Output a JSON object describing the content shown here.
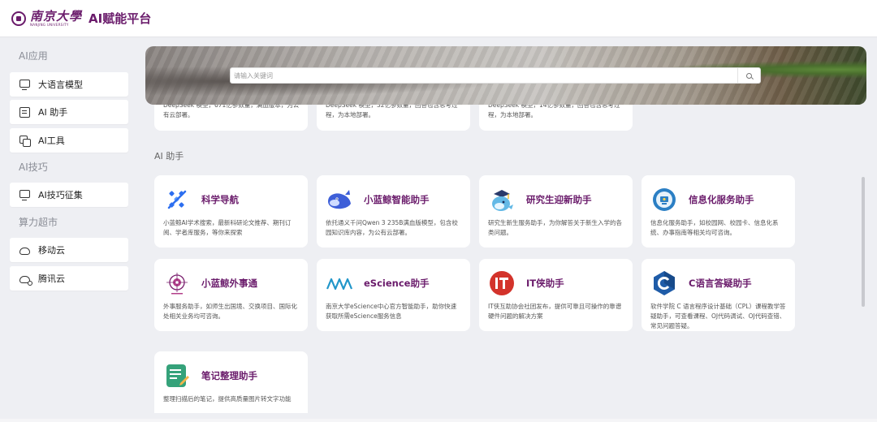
{
  "header": {
    "logo_cn": "南京大學",
    "logo_en": "NANJING UNIVERSITY",
    "title": "AI赋能平台"
  },
  "sidebar": {
    "sections": [
      {
        "label": "AI应用"
      },
      {
        "label": "AI技巧"
      },
      {
        "label": "算力超市"
      }
    ],
    "items": [
      {
        "label": "大语言模型",
        "icon": "monitor-icon"
      },
      {
        "label": "AI 助手",
        "icon": "chat-icon"
      },
      {
        "label": "AI工具",
        "icon": "tools-icon"
      },
      {
        "label": "AI技巧征集",
        "icon": "monitor-icon"
      },
      {
        "label": "移动云",
        "icon": "cloud-icon"
      },
      {
        "label": "腾讯云",
        "icon": "cloud-link-icon"
      }
    ]
  },
  "search": {
    "placeholder": "请输入关键词",
    "value": ""
  },
  "partial_cards": [
    {
      "desc": "DeepSeek 模型，671亿参数量，满血版本，为公有云部署。"
    },
    {
      "desc": "DeepSeek 模型，32亿参数量，回答包含思考过程，为本地部署。"
    },
    {
      "desc": "DeepSeek 模型，14亿参数量，回答包含思考过程，为本地部署。"
    }
  ],
  "ai_assistant": {
    "section_title": "AI 助手",
    "cards": [
      {
        "name": "科学导航",
        "desc": "小蓝鲸AI学术搜索，最新科研论文推荐、期刊订阅、学者库服务，等你来探索",
        "icon": "science-nav-icon"
      },
      {
        "name": "小蓝鲸智能助手",
        "desc": "依托通义千问Qwen 3 235B满血版模型，包含校园知识库内容，为公有云部署。",
        "icon": "whale-icon"
      },
      {
        "name": "研究生迎新助手",
        "desc": "研究生新生服务助手，为你解答关于新生入学的各类问题。",
        "icon": "graduate-whale-icon"
      },
      {
        "name": "信息化服务助手",
        "desc": "信息化服务助手，如校园网、校园卡、信息化系统、办事指南等相关均可咨询。",
        "icon": "info-service-icon"
      },
      {
        "name": "小蓝鲸外事通",
        "desc": "外事服务助手，如师生出国境、交换项目、国际化处相关业务均可咨询。",
        "icon": "foreign-affairs-icon"
      },
      {
        "name": "eScience助手",
        "desc": "南京大学eScience中心官方智能助手，助你快速获取所需eScience服务信息",
        "icon": "escience-icon"
      },
      {
        "name": "IT侠助手",
        "desc": "IT侠互助协会社团发布，提供可靠且可操作的靠谱硬件问题的解决方案",
        "icon": "it-hero-icon"
      },
      {
        "name": "C语言答疑助手",
        "desc": "软件学院 C 语言程序设计基础（CPL）课程教学答疑助手，可查看课程、OJ代码调试、OJ代码查错、常见问题答疑。",
        "icon": "c-language-icon"
      },
      {
        "name": "笔记整理助手",
        "desc": "整理扫描后的笔记，提供高质量图片转文字功能",
        "icon": "notes-icon"
      }
    ]
  },
  "colors": {
    "brand": "#6a1b6b",
    "background": "#eeeff3",
    "card": "#ffffff"
  }
}
